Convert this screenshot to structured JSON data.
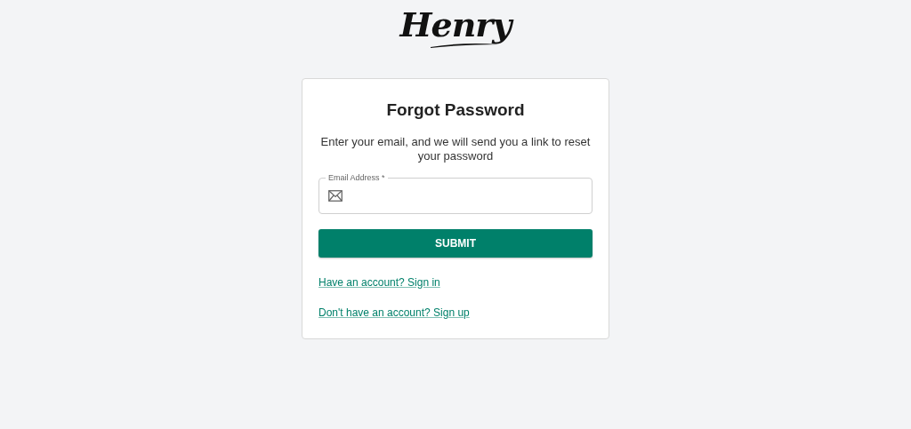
{
  "logo": "Henry",
  "title": "Forgot Password",
  "description": "Enter your email, and we will send you a link to reset your password",
  "email_field": {
    "label": "Email Address",
    "required_mark": "*"
  },
  "submit_button": "SUBMIT",
  "links": [
    "Have an account? Sign in",
    "Don't have an account? Sign up"
  ]
}
